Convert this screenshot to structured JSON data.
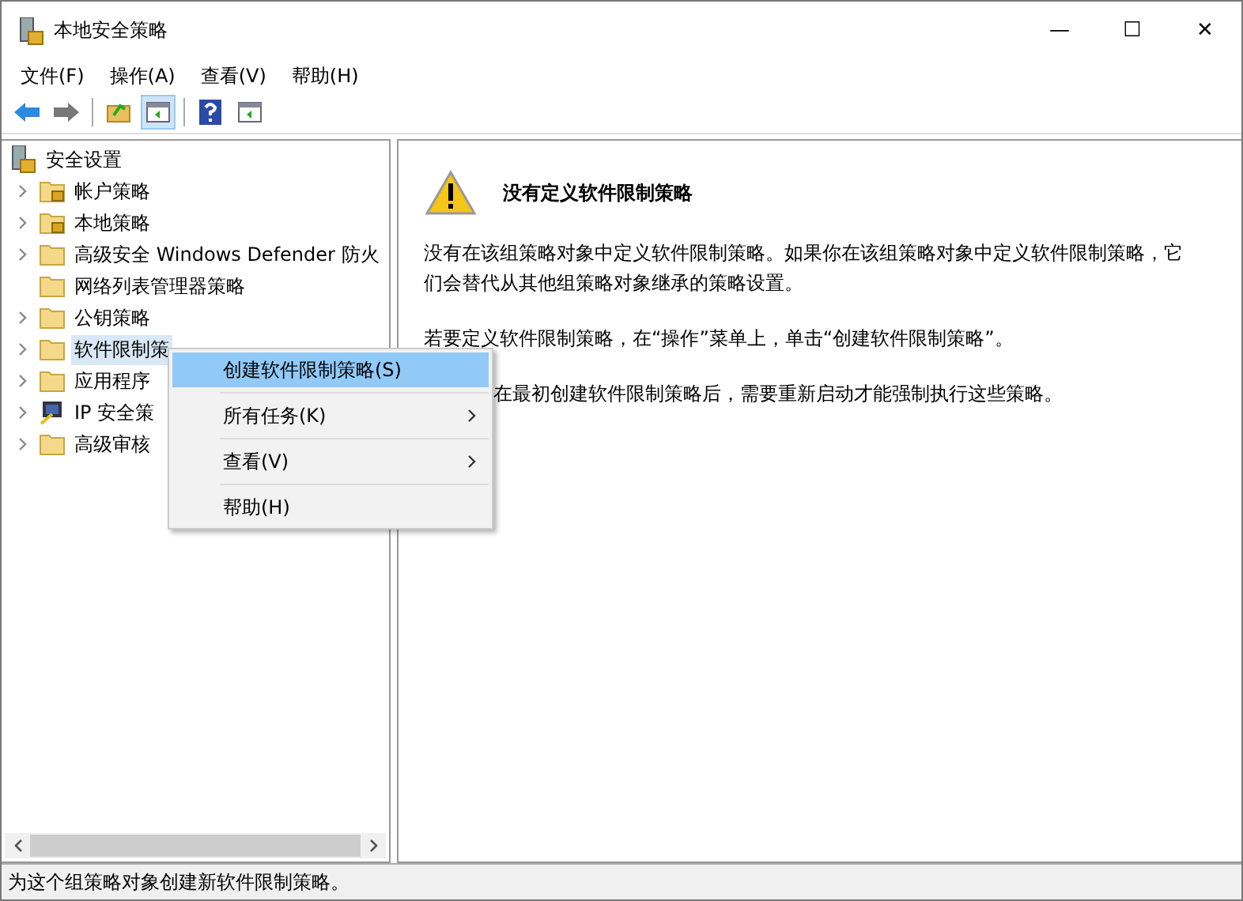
{
  "window": {
    "title": "本地安全策略",
    "controls": [
      "—",
      "☐",
      "✕"
    ]
  },
  "menubar": [
    "文件(F)",
    "操作(A)",
    "查看(V)",
    "帮助(H)"
  ],
  "toolbar": [
    {
      "kind": "back"
    },
    {
      "kind": "forward"
    },
    {
      "kind": "sep"
    },
    {
      "kind": "up"
    },
    {
      "kind": "pane",
      "selected": true
    },
    {
      "kind": "sep"
    },
    {
      "kind": "help"
    },
    {
      "kind": "pane2",
      "selected": false
    }
  ],
  "tree": {
    "root": "安全设置",
    "items": [
      {
        "label": "帐户策略",
        "kind": "lockfolder",
        "expandable": true,
        "selected": false
      },
      {
        "label": "本地策略",
        "kind": "lockfolder",
        "expandable": true,
        "selected": false
      },
      {
        "label": "高级安全 Windows Defender 防火",
        "kind": "folder",
        "expandable": true,
        "selected": false
      },
      {
        "label": "网络列表管理器策略",
        "kind": "folder",
        "expandable": false,
        "selected": false
      },
      {
        "label": "公钥策略",
        "kind": "folder",
        "expandable": true,
        "selected": false
      },
      {
        "label": "软件限制策",
        "kind": "folder",
        "expandable": true,
        "selected": true
      },
      {
        "label": "应用程序",
        "kind": "folder",
        "expandable": true,
        "selected": false
      },
      {
        "label": "IP 安全策",
        "kind": "computer",
        "expandable": true,
        "selected": false
      },
      {
        "label": "高级审核",
        "kind": "folder",
        "expandable": true,
        "selected": false
      }
    ]
  },
  "content": {
    "heading": "没有定义软件限制策略",
    "paragraphs": [
      "没有在该组策略对象中定义软件限制策略。如果你在该组策略对象中定义软件限制策略，它们会替代从其他组策略对象继承的策略设置。",
      "若要定义软件限制策略，在“操作”菜单上，单击“创建软件限制策略”。",
      "在最初创建软件限制策略后，需要重新启动才能强制执行这些策略。"
    ]
  },
  "context_menu": [
    {
      "label": "创建软件限制策略(S)",
      "submenu": false,
      "selected": true
    },
    {
      "label": "所有任务(K)",
      "submenu": true,
      "selected": false
    },
    {
      "label": "查看(V)",
      "submenu": true,
      "selected": false
    },
    {
      "label": "帮助(H)",
      "submenu": false,
      "selected": false
    }
  ],
  "status_bar": "为这个组策略对象创建新软件限制策略。"
}
